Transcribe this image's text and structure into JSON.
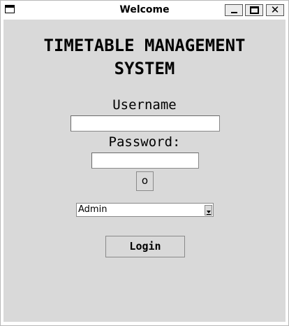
{
  "window": {
    "title": "Welcome",
    "close_glyph": "✕"
  },
  "heading": {
    "line1": "TIMETABLE MANAGEMENT",
    "line2": "SYSTEM"
  },
  "form": {
    "username_label": "Username",
    "username_value": "",
    "password_label": "Password:",
    "password_value": "",
    "toggle_glyph": "o",
    "role_selected": "Admin",
    "login_label": "Login"
  }
}
